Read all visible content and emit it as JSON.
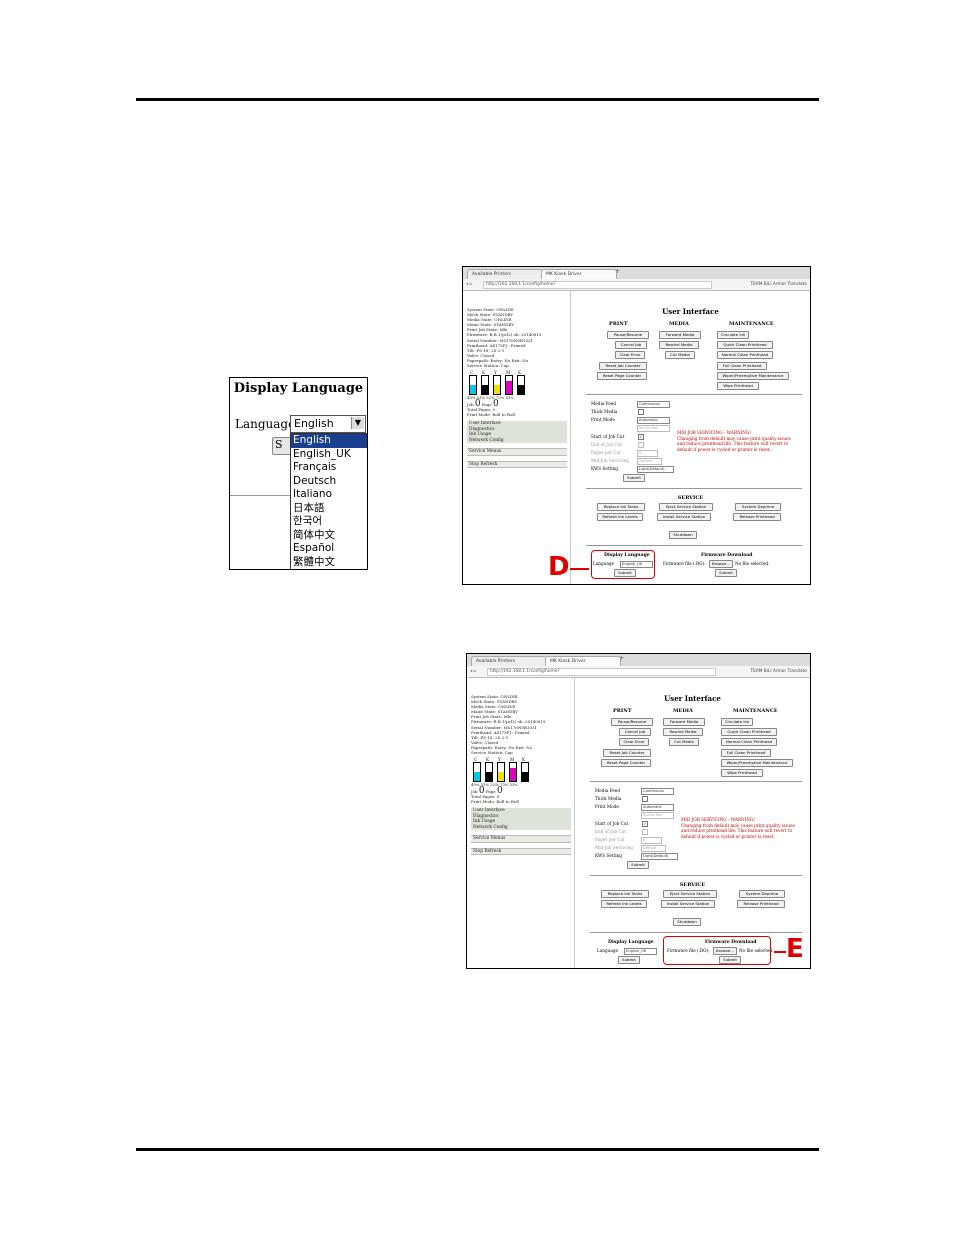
{
  "display_language_crop": {
    "title": "Display Language",
    "language_label": "Language",
    "selected_value": "English",
    "behind_button_label": "S",
    "options": [
      "English",
      "English_UK",
      "Français",
      "Deutsch",
      "Italiano",
      "日本語",
      "한국어",
      "简体中文",
      "Español",
      "繁體中文"
    ]
  },
  "screenshot_d": {
    "tabs": [
      "Available Printers",
      "MK Kiosk Driver"
    ],
    "url": "http://192.168.1.1/config/home?",
    "bookmarks": "TEAM BiLi Armor  Translate",
    "status_lines": [
      "System State: ONLINE",
      "Mech State: STANDBY",
      "Media State: ONLINE",
      "Maint State: STANDBY",
      "Print Job State: Idle",
      "Firmware: R.B.1(pcl2) ob: 20140815",
      "Serial Number: M5176N0R1031",
      "Printhead: A4175FJ - Primed",
      "Tilt: PS-18; 2S-2-1",
      "Valve: Closed",
      "Paperpath: Entry: No Exit: No",
      "Service Station: Cap"
    ],
    "ink_labels": [
      "C",
      "K",
      "Y",
      "M",
      "K"
    ],
    "ink_percent_line": "49% 53% 52% 73% 53%",
    "job_label": "Job",
    "job_value": "0",
    "page_label": "Page",
    "page_value": "0",
    "total_pages": "Total Pages: 0",
    "print_mode": "Print Mode: Roll to Roll",
    "menu_items": [
      "User Interface",
      "Diagnostics",
      "Ink Usage",
      "Network Config"
    ],
    "service_menus": "Service Menus",
    "stop_refresh": "Stop Refresh",
    "heading": "User Interface",
    "col_print": "PRINT",
    "col_media": "MEDIA",
    "col_maint": "MAINTENANCE",
    "print_buttons": [
      "Pause/Resume",
      "Cancel Job",
      "Clear Error",
      "Reset Job Counter",
      "Reset Page Counter"
    ],
    "media_buttons": [
      "Forward Media",
      "Rewind Media",
      "Cut Media"
    ],
    "maint_buttons": [
      "Circulate Ink",
      "Quick Clean Printhead",
      "Normal Clean Printhead",
      "Full Clean Printhead",
      "Wiper/Preemptive Maintenance",
      "Wipe Printhead"
    ],
    "media_feed_label": "Media Feed",
    "media_feed_value": "Continuous",
    "thick_media_label": "Thick Media",
    "print_mode_label": "Print Mode",
    "print_mode_value": "Automatic",
    "print_mode_sub": "Roll to Roll",
    "start_job_cut": "Start of Job Cut",
    "end_job_cut": "End of Job Cut",
    "pages_per_cut": "Pages per Cut",
    "pages_per_cut_value": "0",
    "mid_job_servicing": "Mid-Job Servicing",
    "mid_job_value": "Default",
    "kws_setting": "KWS Setting",
    "kws_value": "Light(Default)",
    "submit": "Submit",
    "warning_lines": [
      "MID JOB SERVICING - WARNING!",
      "Changing from default may cause print quality issues",
      "and reduce printhead life. This feature will revert to",
      "default if power is cycled or printer is reset."
    ],
    "service_heading": "SERVICE",
    "service_buttons": [
      "Replace Ink Tanks",
      "Eject Service Station",
      "System Deprime",
      "Refresh Ink Levels",
      "Install Service Station",
      "Release Printhead",
      "Shutdown"
    ],
    "display_language_title": "Display Language",
    "language_label": "Language",
    "language_value": "English_UK",
    "firmware_title": "Firmware Download",
    "firmware_label": "Firmware file (.BO):",
    "browse": "Browse...",
    "no_file": "No file selected.",
    "callout": "D"
  },
  "screenshot_e": {
    "tabs": [
      "Available Printers",
      "MK Kiosk Driver"
    ],
    "url": "http://192.168.1.1/config/home?",
    "bookmarks": "TEAM BiLi Armor  Translate",
    "status_lines": [
      "System State: ONLINE",
      "Mech State: STANDBY",
      "Media State: ONLINE",
      "Maint State: STANDBY",
      "Print Job State: Idle",
      "Firmware: R.B.1(pcl2) ob: 20140815",
      "Serial Number: M5176N0R1031",
      "Printhead: A4175FJ - Primed",
      "Tilt: PS-18; 2S-2-1",
      "Valve: Closed",
      "Paperpath: Entry: No Exit: No",
      "Service Station: Cap"
    ],
    "ink_labels": [
      "C",
      "K",
      "Y",
      "M",
      "K"
    ],
    "ink_percent_line": "49% 53% 52% 73% 53%",
    "job_label": "Job",
    "job_value": "0",
    "page_label": "Page",
    "page_value": "0",
    "total_pages": "Total Pages: 0",
    "print_mode": "Print Mode: Roll to Roll",
    "menu_items": [
      "User Interface",
      "Diagnostics",
      "Ink Usage",
      "Network Config"
    ],
    "service_menus": "Service Menus",
    "stop_refresh": "Stop Refresh",
    "heading": "User Interface",
    "col_print": "PRINT",
    "col_media": "MEDIA",
    "col_maint": "MAINTENANCE",
    "print_buttons": [
      "Pause/Resume",
      "Cancel Job",
      "Clear Error",
      "Reset Job Counter",
      "Reset Page Counter"
    ],
    "media_buttons": [
      "Forward Media",
      "Rewind Media",
      "Cut Media"
    ],
    "maint_buttons": [
      "Circulate Ink",
      "Quick Clean Printhead",
      "Normal Clean Printhead",
      "Full Clean Printhead",
      "Wiper/Preemptive Maintenance",
      "Wipe Printhead"
    ],
    "media_feed_label": "Media Feed",
    "media_feed_value": "Continuous",
    "thick_media_label": "Thick Media",
    "print_mode_label": "Print Mode",
    "print_mode_value": "Automatic",
    "print_mode_sub": "Roll to Roll",
    "start_job_cut": "Start of Job Cut",
    "end_job_cut": "End of Job Cut",
    "pages_per_cut": "Pages per Cut",
    "pages_per_cut_value": "0",
    "mid_job_servicing": "Mid-Job Servicing",
    "mid_job_value": "Default",
    "kws_setting": "KWS Setting",
    "kws_value": "Light(Default)",
    "submit": "Submit",
    "warning_lines": [
      "MID JOB SERVICING - WARNING!",
      "Changing from default may cause print quality issues",
      "and reduce printhead life. This feature will revert to",
      "default if power is cycled or printer is reset."
    ],
    "service_heading": "SERVICE",
    "service_buttons": [
      "Replace Ink Tanks",
      "Eject Service Station",
      "System Deprime",
      "Refresh Ink Levels",
      "Install Service Station",
      "Release Printhead",
      "Shutdown"
    ],
    "display_language_title": "Display Language",
    "language_label": "Language",
    "language_value": "English_UK",
    "firmware_title": "Firmware Download",
    "firmware_label": "Firmware file (.BO):",
    "browse": "Browse...",
    "no_file": "No file selected.",
    "callout": "E"
  },
  "colors": {
    "callout_red": "#e00000",
    "warning_red": "#c00000",
    "selected_option_bg": "#1a3f8f",
    "ink_cyan": "#00c8e8",
    "ink_black": "#000000",
    "ink_yellow": "#f0e000",
    "ink_magenta": "#e000c0"
  },
  "ink_levels_percent": [
    49,
    53,
    52,
    73,
    53
  ]
}
